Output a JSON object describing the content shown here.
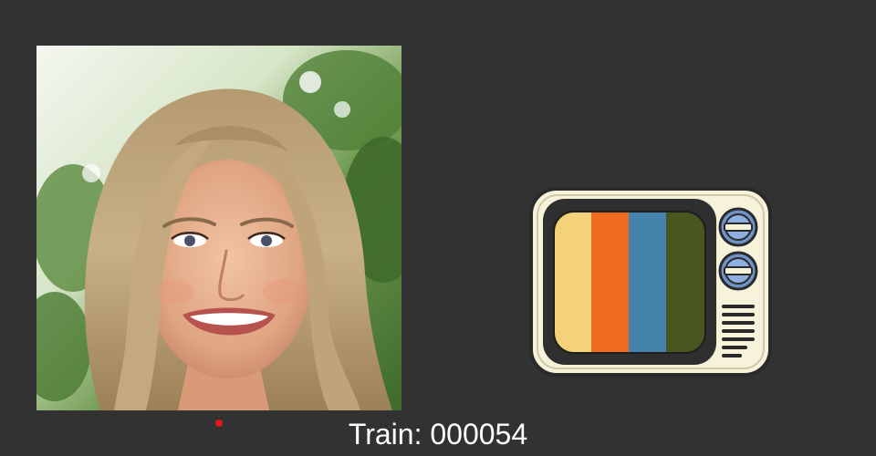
{
  "counter": {
    "label": "Train:",
    "value": "000054"
  },
  "colors": {
    "background": "#323232",
    "marker": "#e01818",
    "tv_bars": [
      "#f3d27a",
      "#f06a1f",
      "#4683ac",
      "#47571f"
    ]
  },
  "icons": {
    "tv": "retro-tv-icon",
    "photo": "face-photo"
  }
}
